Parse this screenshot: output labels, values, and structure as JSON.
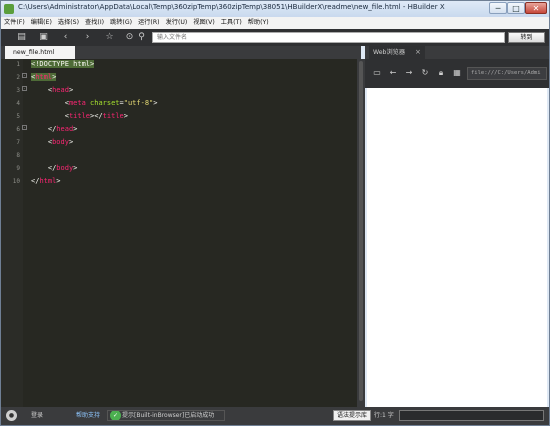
{
  "window": {
    "title": "C:\\Users\\Administrator\\AppData\\Local\\Temp\\360zipTemp\\360zipTemp\\38051\\HBuilderX\\readme\\new_file.html - HBuilder X",
    "min": "─",
    "max": "□",
    "close": "✕"
  },
  "menu": [
    "文件(F)",
    "编辑(E)",
    "选择(S)",
    "查找(I)",
    "跳转(G)",
    "运行(R)",
    "发行(U)",
    "视图(V)",
    "工具(T)",
    "帮助(Y)"
  ],
  "toolbar": {
    "search_placeholder": "输入文件名",
    "run_label": "转到",
    "icons": [
      "new-file-icon",
      "save-icon",
      "back-icon",
      "forward-icon",
      "bookmark-icon",
      "run-icon",
      "search-icon"
    ]
  },
  "editor": {
    "tab_label": "new_file.html",
    "line_numbers": [
      "1",
      "2",
      "3",
      "4",
      "5",
      "6",
      "7",
      "8",
      "9",
      "10"
    ]
  },
  "web": {
    "tab_label": "Web浏览器",
    "close": "×",
    "url": "file:///C:/Users/Admi",
    "icons": [
      "screen-icon",
      "back-icon",
      "forward-icon",
      "refresh-icon",
      "lock-icon",
      "grid-icon"
    ]
  },
  "status": {
    "login": "登录",
    "account": "帮助支持",
    "message": "提示[Built-inBrowser]已启动成功",
    "hint_button": "语法提示库",
    "line_info": "行:1 字"
  },
  "colors": {
    "editor_bg": "#272822",
    "tag": "#f92672",
    "attr": "#a6e22e",
    "string": "#e6db74"
  }
}
